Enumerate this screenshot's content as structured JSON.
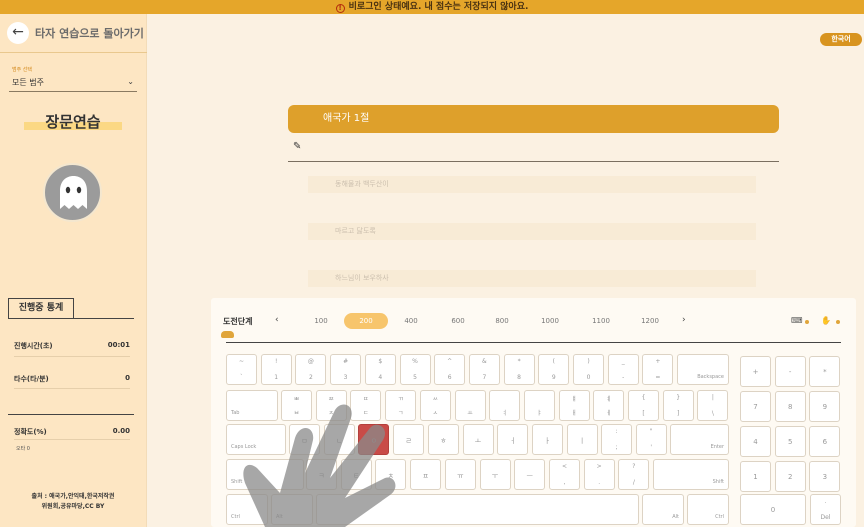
{
  "banner": {
    "text": "비로그인 상태예요. 내 점수는 저장되지 않아요."
  },
  "sidebar": {
    "back_label": "타자 연습으로 돌아가기",
    "category_label": "범주 선택",
    "category_value": "모든 범주",
    "mode_title": "장문연습",
    "stats_tab": "진행중 통계",
    "stats": {
      "time_label": "진행시간(초)",
      "time_value": "00:01",
      "speed_label": "타수(타/분)",
      "speed_value": "0",
      "accuracy_label": "정확도(%)",
      "accuracy_value": "0.00",
      "typo_label": "오타 0"
    },
    "source_line1": "출처 : 애국가,안익태,한국저작권",
    "source_line2": "위원회,공유마당,CC BY"
  },
  "lang_badge": "한국어",
  "passage": {
    "title": "애국가 1절",
    "lines": [
      "동해물과 백두산이",
      "마르고 닳도록",
      "하느님이 보우하사"
    ]
  },
  "levels": {
    "label": "도전단계",
    "items": [
      "100",
      "200",
      "400",
      "600",
      "800",
      "1000",
      "1100",
      "1200"
    ],
    "active": "200"
  },
  "keyboard": {
    "row1": [
      {
        "t": "~",
        "b": "`"
      },
      {
        "t": "!",
        "b": "1"
      },
      {
        "t": "@",
        "b": "2"
      },
      {
        "t": "#",
        "b": "3"
      },
      {
        "t": "$",
        "b": "4"
      },
      {
        "t": "%",
        "b": "5"
      },
      {
        "t": "^",
        "b": "6"
      },
      {
        "t": "&",
        "b": "7"
      },
      {
        "t": "*",
        "b": "8"
      },
      {
        "t": "(",
        "b": "9"
      },
      {
        "t": ")",
        "b": "0"
      },
      {
        "t": "_",
        "b": "-"
      },
      {
        "t": "+",
        "b": "="
      }
    ],
    "backspace": "Backspace",
    "tab": "Tab",
    "row2": [
      {
        "t": "ㅃ",
        "b": "ㅂ"
      },
      {
        "t": "ㅉ",
        "b": "ㅈ"
      },
      {
        "t": "ㄸ",
        "b": "ㄷ"
      },
      {
        "t": "ㄲ",
        "b": "ㄱ"
      },
      {
        "t": "ㅆ",
        "b": "ㅅ"
      },
      {
        "t": "",
        "b": "ㅛ"
      },
      {
        "t": "",
        "b": "ㅕ"
      },
      {
        "t": "",
        "b": "ㅑ"
      },
      {
        "t": "ㅒ",
        "b": "ㅐ"
      },
      {
        "t": "ㅖ",
        "b": "ㅔ"
      },
      {
        "t": "{",
        "b": "["
      },
      {
        "t": "}",
        "b": "]"
      },
      {
        "t": "|",
        "b": "\\"
      }
    ],
    "caps": "Caps Lock",
    "row3": [
      "ㅁ",
      "ㄴ",
      "ㅇ",
      "ㄹ",
      "ㅎ",
      "ㅗ",
      "ㅓ",
      "ㅏ",
      "ㅣ"
    ],
    "row3_punct": [
      {
        "t": ":",
        "b": ";"
      },
      {
        "t": "\"",
        "b": "'"
      }
    ],
    "enter": "Enter",
    "shift": "Shift",
    "row4": [
      "ㅋ",
      "ㅌ",
      "ㅊ",
      "ㅍ",
      "ㅠ",
      "ㅜ",
      "ㅡ"
    ],
    "row4_punct": [
      {
        "t": "<",
        "b": ","
      },
      {
        "t": ">",
        "b": "."
      },
      {
        "t": "?",
        "b": "/"
      }
    ],
    "ctrl": "Ctrl",
    "alt": "Alt",
    "numpad": {
      "row1": [
        "+",
        "-",
        "*"
      ],
      "row2": [
        "7",
        "8",
        "9"
      ],
      "row3": [
        "4",
        "5",
        "6"
      ],
      "row4": [
        "1",
        "2",
        "3"
      ],
      "zero": "0",
      "del_top": ".",
      "del": "Del"
    }
  },
  "colors": {
    "accent": "#dea02b",
    "banner": "#e5a62a",
    "sidebar": "#fde6c3",
    "target_key": "#c94b47"
  }
}
